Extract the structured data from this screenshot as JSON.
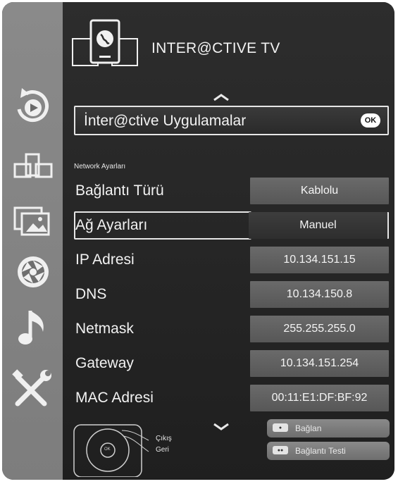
{
  "header": {
    "title": "INTER@CTIVE TV"
  },
  "sidebar": {
    "items": [
      {
        "icon": "source-cycle-icon"
      },
      {
        "icon": "screens-icon"
      },
      {
        "icon": "photo-gallery-icon"
      },
      {
        "icon": "camera-aperture-icon"
      },
      {
        "icon": "music-note-icon"
      },
      {
        "icon": "tools-icon"
      }
    ]
  },
  "apps": {
    "label": "İnter@ctive Uygulamalar",
    "ok": "OK"
  },
  "network": {
    "section_label": "Network Ayarları",
    "rows": [
      {
        "label": "Bağlantı Türü",
        "value": "Kablolu"
      },
      {
        "label": "Ağ Ayarları",
        "value": "Manuel",
        "selected": true
      },
      {
        "label": "IP Adresi",
        "value": "10.134.151.15"
      },
      {
        "label": "DNS",
        "value": "10.134.150.8"
      },
      {
        "label": "Netmask",
        "value": "255.255.255.0"
      },
      {
        "label": "Gateway",
        "value": "10.134.151.254"
      },
      {
        "label": "MAC Adresi",
        "value": "00:11:E1:DF:BF:92"
      }
    ]
  },
  "footer": {
    "exit_label": "Çıkış",
    "back_label": "Geri",
    "remote_center": "OK",
    "connect_label": "Bağlan",
    "connection_test_label": "Bağlantı Testi"
  }
}
